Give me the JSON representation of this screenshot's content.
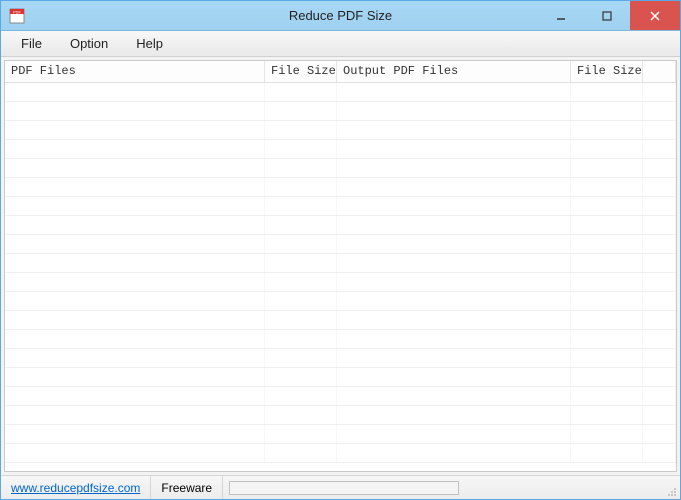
{
  "window": {
    "title": "Reduce PDF Size"
  },
  "menubar": {
    "items": [
      "File",
      "Option",
      "Help"
    ]
  },
  "table": {
    "columns": [
      "PDF Files",
      "File Size",
      "Output PDF Files",
      "File Size",
      ""
    ],
    "rows": []
  },
  "statusbar": {
    "link_label": "www.reducepdfsize.com",
    "license_label": "Freeware"
  },
  "colors": {
    "titlebar": "#9fd1f0",
    "border": "#5aa9e6",
    "close": "#d9534f",
    "link": "#0066cc"
  }
}
